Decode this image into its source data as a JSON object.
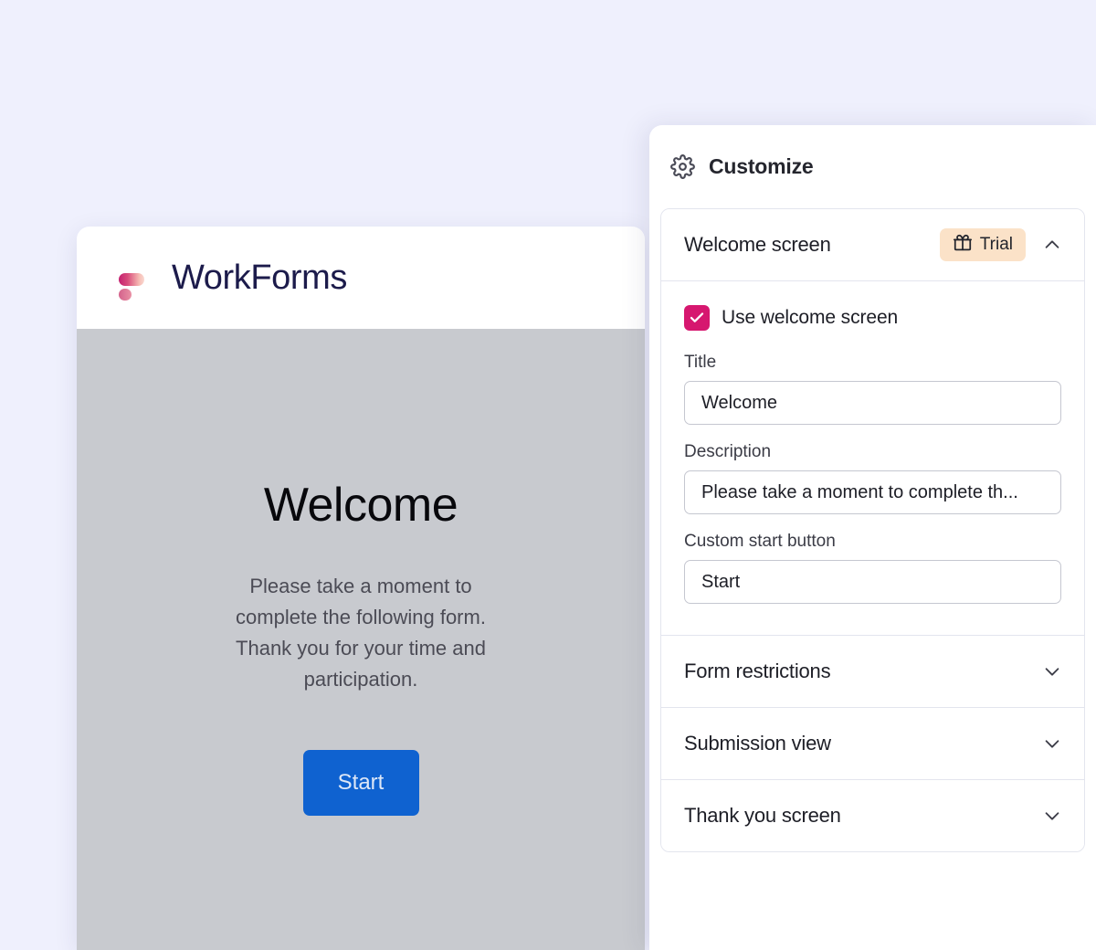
{
  "form_preview": {
    "brand_name": "WorkForms",
    "logo_icon": "workforms-logo-icon",
    "welcome_title": "Welcome",
    "welcome_description": "Please take a moment to complete the following form. Thank you for your time and participation.",
    "start_button_label": "Start",
    "start_button_color": "#0f62d0",
    "body_background": "#c8cacf"
  },
  "panel": {
    "title": "Customize",
    "gear_icon": "gear-icon",
    "sections": [
      {
        "id": "welcome-screen",
        "title": "Welcome screen",
        "expanded": true,
        "chevron_icon": "chevron-up-icon",
        "badge": {
          "label": "Trial",
          "icon": "gift-icon",
          "background": "#fbe2c8"
        },
        "checkbox": {
          "label": "Use welcome screen",
          "checked": true,
          "color": "#d6176f"
        },
        "fields": [
          {
            "label": "Title",
            "value": "Welcome",
            "placeholder": "Title"
          },
          {
            "label": "Description",
            "value": "Please take a moment to complete th...",
            "placeholder": "Description"
          },
          {
            "label": "Custom start button",
            "value": "Start",
            "placeholder": "Start"
          }
        ]
      },
      {
        "id": "form-restrictions",
        "title": "Form restrictions",
        "expanded": false,
        "chevron_icon": "chevron-down-icon"
      },
      {
        "id": "submission-view",
        "title": "Submission view",
        "expanded": false,
        "chevron_icon": "chevron-down-icon"
      },
      {
        "id": "thank-you-screen",
        "title": "Thank you screen",
        "expanded": false,
        "chevron_icon": "chevron-down-icon"
      }
    ]
  },
  "colors": {
    "page_background": "#eff0fd",
    "accent_pink": "#d6176f",
    "accent_blue": "#0f62d0",
    "badge_peach": "#fbe2c8"
  }
}
